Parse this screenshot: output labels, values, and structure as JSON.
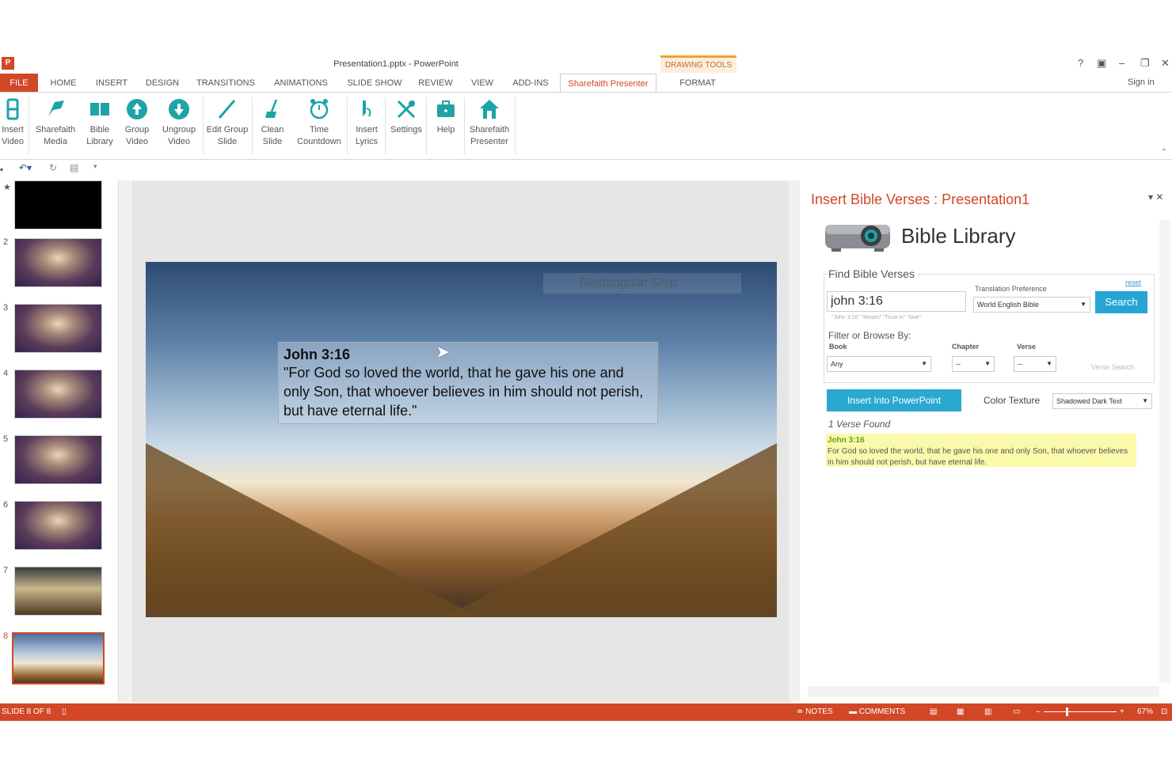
{
  "window": {
    "title": "Presentation1.pptx - PowerPoint",
    "app_icon": "P",
    "drawing_tools": "DRAWING TOOLS",
    "help": "?",
    "sign_in": "Sign in"
  },
  "tabs": [
    "FILE",
    "HOME",
    "INSERT",
    "DESIGN",
    "TRANSITIONS",
    "ANIMATIONS",
    "SLIDE SHOW",
    "REVIEW",
    "VIEW",
    "ADD-INS",
    "Sharefaith Presenter",
    "FORMAT"
  ],
  "ribbon": [
    {
      "l1": "Insert",
      "l2": "Video",
      "icon": "insert-video-icon"
    },
    {
      "l1": "Sharefaith",
      "l2": "Media",
      "icon": "sharefaith-media-icon"
    },
    {
      "l1": "Bible",
      "l2": "Library",
      "icon": "bible-library-icon"
    },
    {
      "l1": "Group",
      "l2": "Video",
      "icon": "group-video-icon"
    },
    {
      "l1": "Ungroup",
      "l2": "Video",
      "icon": "ungroup-video-icon"
    },
    {
      "l1": "Edit Group",
      "l2": "Slide",
      "icon": "edit-group-slide-icon"
    },
    {
      "l1": "Clean",
      "l2": "Slide",
      "icon": "clean-slide-icon"
    },
    {
      "l1": "Time",
      "l2": "Countdown",
      "icon": "time-countdown-icon"
    },
    {
      "l1": "Insert",
      "l2": "Lyrics",
      "icon": "insert-lyrics-icon"
    },
    {
      "l1": "Settings",
      "l2": "",
      "icon": "settings-icon"
    },
    {
      "l1": "Help",
      "l2": "",
      "icon": "help-icon"
    },
    {
      "l1": "Sharefaith",
      "l2": "Presenter",
      "icon": "sharefaith-presenter-icon"
    }
  ],
  "thumbnails": [
    "",
    "2",
    "3",
    "4",
    "5",
    "6",
    "7",
    "8"
  ],
  "slide": {
    "snip_label": "Rectangular Snip",
    "verse_ref": "John 3:16",
    "verse_text": "\"For God so loved the world, that he gave his one and only Son, that whoever believes in him should not perish, but have eternal life.\""
  },
  "pane": {
    "title": "Insert Bible Verses : Presentation1",
    "library_title": "Bible Library",
    "find_legend": "Find Bible Verses",
    "search_value": "john 3:16",
    "search_hint": "\"John 3:16\"  \"Moses\"  \"Trust in\" \"love\"",
    "translation_label": "Translation Preference",
    "translation_value": "World English Bible",
    "reset": "reset",
    "search_btn": "Search",
    "filter_label": "Filter or Browse By:",
    "book_label": "Book",
    "chapter_label": "Chapter",
    "verse_label": "Verse",
    "book_value": "Any",
    "chapter_value": "--",
    "verse_value": "--",
    "verse_search": "Verse Search",
    "insert_btn": "Insert Into PowerPoint",
    "color_texture_label": "Color Texture",
    "color_texture_value": "Shadowed Dark Text",
    "found": "1 Verse Found",
    "result_ref": "John 3:16",
    "result_text": "For God so loved the world, that he gave his one and only Son, that whoever believes in him should not perish, but have eternal life."
  },
  "status": {
    "slide": "SLIDE 8 OF 8",
    "notes": "NOTES",
    "comments": "COMMENTS",
    "zoom": "67%"
  },
  "colors": {
    "accent": "#d24726",
    "teal": "#28a4d4",
    "highlight": "#fafaaa"
  }
}
